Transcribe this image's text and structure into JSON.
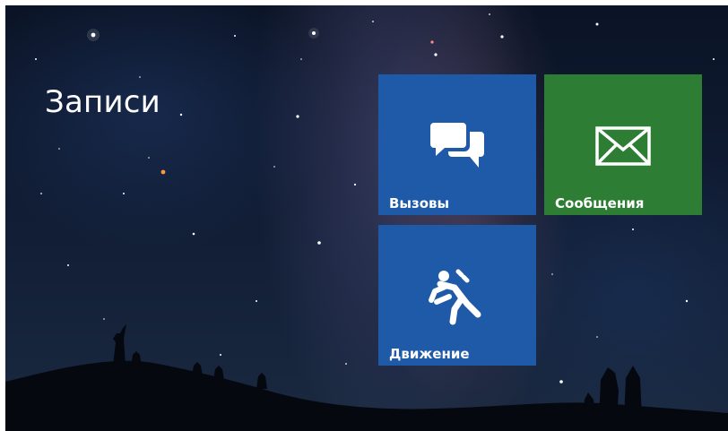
{
  "screen": {
    "title": "Записи"
  },
  "tiles": [
    {
      "label": "Вызовы",
      "icon": "chat-bubbles-icon",
      "color": "#1e5aa8"
    },
    {
      "label": "Сообщения",
      "icon": "envelope-icon",
      "color": "#2d7d34"
    },
    {
      "label": "Движение",
      "icon": "running-man-icon",
      "color": "#1e5aa8"
    }
  ],
  "background": {
    "description_icon": "starry-night-background"
  }
}
